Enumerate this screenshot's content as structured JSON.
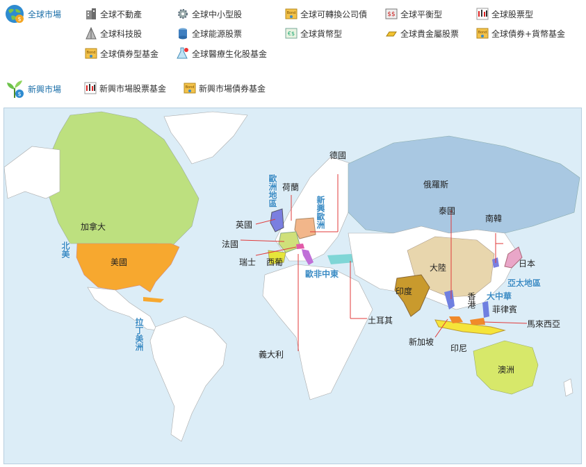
{
  "global_market": {
    "title": "全球市場",
    "links": [
      {
        "label": "全球不動產",
        "icon": "building-icon"
      },
      {
        "label": "全球中小型股",
        "icon": "gear-icon"
      },
      {
        "label": "全球可轉換公司債",
        "icon": "bond-icon"
      },
      {
        "label": "全球平衡型",
        "icon": "balance-icon"
      },
      {
        "label": "全球股票型",
        "icon": "candlestick-icon"
      },
      {
        "label": "全球科技股",
        "icon": "tech-icon"
      },
      {
        "label": "全球能源股票",
        "icon": "barrel-icon"
      },
      {
        "label": "全球貨幣型",
        "icon": "currency-icon"
      },
      {
        "label": "全球貴金屬股票",
        "icon": "gold-bar-icon"
      },
      {
        "label": "全球債券+貨幣基金",
        "icon": "bond-icon"
      },
      {
        "label": "全球債券型基金",
        "icon": "bond-icon"
      },
      {
        "label": "全球醫療生化股基金",
        "icon": "flask-icon"
      }
    ]
  },
  "emerging_market": {
    "title": "新興市場",
    "links": [
      {
        "label": "新興市場股票基金",
        "icon": "candlestick-icon"
      },
      {
        "label": "新興市場債券基金",
        "icon": "bond-icon"
      }
    ]
  },
  "map": {
    "regions": {
      "north_america": "北美",
      "latin_america": "拉丁美洲",
      "europe": "歐洲地區",
      "emerging_europe": "新興歐洲",
      "europe_middle_east": "歐非中東",
      "asia_pacific": "亞太地區",
      "greater_china": "大中華"
    },
    "countries": {
      "canada": "加拿大",
      "usa": "美國",
      "netherlands": "荷蘭",
      "germany": "德國",
      "uk": "英國",
      "france": "法國",
      "switzerland": "瑞士",
      "spain_portugal": "西葡",
      "italy": "義大利",
      "turkey": "土耳其",
      "russia": "俄羅斯",
      "china": "大陸",
      "india": "印度",
      "thailand": "泰國",
      "korea": "南韓",
      "japan": "日本",
      "hong_kong": "香港",
      "philippines": "菲律賓",
      "malaysia": "馬來西亞",
      "singapore": "新加坡",
      "indonesia": "印尼",
      "australia": "澳洲"
    }
  },
  "colors": {
    "ocean": "#dcedf7",
    "land": "#ffffff",
    "canada": "#bde07f",
    "usa": "#f7a82f",
    "russia": "#a9c8e2",
    "china": "#e8d6ad",
    "india": "#c99a2d",
    "australia": "#d7e86a",
    "region_text": "#3a8bc4",
    "link_text": "#1a6ea8"
  }
}
